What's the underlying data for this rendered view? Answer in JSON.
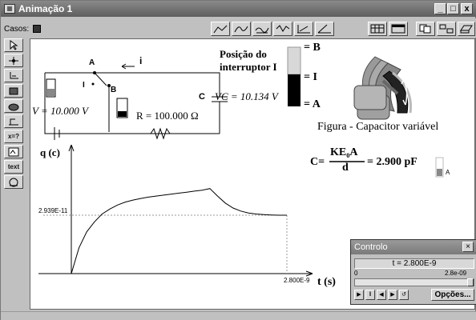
{
  "window": {
    "title": "Animação 1",
    "minimize": "_",
    "maximize": "□",
    "close": "x"
  },
  "toolbar": {
    "casos_label": "Casos:"
  },
  "left_tools": {
    "text_tool": "text",
    "xeq_tool": "x=?"
  },
  "circuit": {
    "node_a": "A",
    "node_b": "B",
    "node_i": "I",
    "current_label": "i",
    "voltage_label": "V = 10.000 V",
    "resistor_label": "R = 100.000 Ω",
    "capacitor_label": "C",
    "vc_label": "VC = 10.134 V"
  },
  "switch": {
    "title_line1": "Posição do",
    "title_line2": "interruptor I",
    "pos_b": "= B",
    "pos_i": "= I",
    "pos_a": "= A"
  },
  "figure": {
    "caption": "Figura - Capacitor variável"
  },
  "formula": {
    "lhs": "C=",
    "numerator": "KE₀A",
    "denominator": "d",
    "result": "= 2.900 pF",
    "slider_label": "A"
  },
  "graph": {
    "y_axis_label": "q (c)",
    "x_axis_label": "t (s)",
    "y_ref_label": "2.939E-11",
    "x_ref_label": "2.800E-9"
  },
  "chart_data": {
    "type": "line",
    "xlabel": "t (s)",
    "ylabel": "q (c)",
    "x_ref": 2.8e-09,
    "y_ref": 2.939e-11,
    "x": [
      0,
      1e-10,
      2e-10,
      3e-10,
      4e-10,
      5e-10,
      6e-10,
      7e-10,
      8e-10,
      9e-10,
      1e-09,
      1.1e-09,
      1.2e-09,
      1.3e-09,
      1.4e-09,
      1.5e-09,
      1.6e-09,
      1.7e-09,
      1.8e-09,
      1.9e-09,
      2e-09,
      2.1e-09,
      2.2e-09,
      2.3e-09,
      2.4e-09,
      2.5e-09,
      2.6e-09,
      2.7e-09,
      2.8e-09
    ],
    "y": [
      0,
      1.3e-11,
      2.1e-11,
      2.6e-11,
      3e-11,
      3.25e-11,
      3.45e-11,
      3.6e-11,
      3.7e-11,
      3.78e-11,
      3.85e-11,
      3.9e-11,
      3.95e-11,
      4e-11,
      4.05e-11,
      4.1e-11,
      4.15e-11,
      4.2e-11,
      4.28e-11,
      3.9e-11,
      3.55e-11,
      3.3e-11,
      3.15e-11,
      3.05e-11,
      3e-11,
      2.97e-11,
      2.95e-11,
      2.94e-11,
      2.939e-11
    ]
  },
  "controlo": {
    "title": "Controlo",
    "close": "×",
    "time_label": "t =",
    "time_value": "2.800E-9",
    "range_min": "0",
    "range_max": "2.8e-09",
    "progress": 1.0,
    "options_button": "Opções..."
  },
  "colors": {
    "titlebar": "#5e5e5e",
    "canvas": "#ffffff",
    "chrome": "#c0c0c0"
  }
}
